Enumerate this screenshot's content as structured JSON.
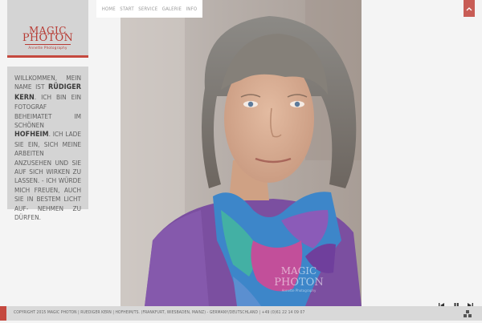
{
  "logo": {
    "line1": "Magic",
    "line2": "Photon",
    "sub": "Annette Photography"
  },
  "intro": {
    "p1": "Willkommen, mein Name ist ",
    "name": "Rüdiger Kern",
    "p2": ". Ich bin ein Fotograf beheimatet im schönen ",
    "place": "Hofheim",
    "p3": ". Ich lade Sie ein, sich meine Arbeiten anzusehen und sie auf sich wirken zu lassen. - Ich würde mich freuen, auch Sie in bestem Licht auf- nehmen zu dürfen."
  },
  "nav": {
    "items": [
      "Home",
      "Start",
      "Service",
      "Galerie",
      "Info"
    ]
  },
  "photo": {
    "watermark_line1": "Magic",
    "watermark_line2": "Photon",
    "watermark_sub": "Annette Photography"
  },
  "footer": {
    "text": "Copyright 2015 Magic Photon | Ruediger Kern | Hofheim/Ts. (Frankfurt, Wiesbaden, Mainz) - Germany/Deutschland | +49 (0)61 22 14 09 07"
  },
  "controls": {
    "prev_icon": "skip-back-icon",
    "pause_icon": "pause-icon",
    "next_icon": "skip-forward-icon",
    "grid_icon": "grid-icon"
  },
  "colors": {
    "accent": "#c5493f",
    "panel": "#d4d4d4",
    "background": "#f4f4f4",
    "footer": "#d9d9d9"
  }
}
